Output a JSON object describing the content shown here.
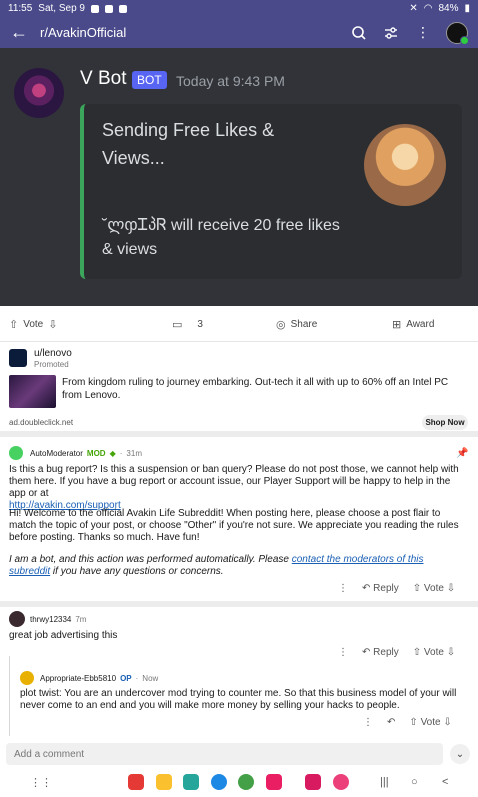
{
  "status_bar": {
    "time": "11:55",
    "date": "Sat, Sep 9",
    "battery": "84%"
  },
  "header": {
    "title": "r/AvakinOfficial"
  },
  "discord": {
    "bot_name": "V Bot",
    "bot_badge": "BOT",
    "timestamp": "Today at 9:43 PM",
    "embed_title": "Sending Free Likes & Views...",
    "embed_description": "˘ლჶᏆპᏒ will receive 20 free likes & views"
  },
  "post_actions": {
    "vote_label": "Vote",
    "comments_count": "3",
    "share_label": "Share",
    "award_label": "Award"
  },
  "promoted": {
    "user": "u/lenovo",
    "tag": "Promoted",
    "text": "From kingdom ruling to journey embarking. Out-tech it all with up to 60% off an Intel PC from Lenovo.",
    "domain": "ad.doubleclick.net",
    "cta": "Shop Now"
  },
  "comments": [
    {
      "author": "AutoModerator",
      "flair": "MOD",
      "age": "31m",
      "para1": "Is this a bug report? Is this a suspension or ban query? Please do not post those, we cannot help with them here. If you have a bug report or account issue, our Player Support will be happy to help in the app or at",
      "link1": "http://avakin.com/support",
      "para2": "Hi! Welcome to the official Avakin Life Subreddit! When posting here, please choose a post flair to match the topic of your post, or choose \"Other\" if you're not sure. We appreciate you reading the rules before posting. Thanks so much. Have fun!",
      "para3_a": "I am a bot, and this action was performed automatically. Please",
      "para3_link": "contact the moderators of this subreddit",
      "para3_b": "if you have any questions or concerns.",
      "reply_label": "Reply",
      "vote_label": "Vote"
    },
    {
      "author": "thrwy12334",
      "age": "7m",
      "text": "great job advertising this",
      "reply_label": "Reply",
      "vote_label": "Vote"
    },
    {
      "author": "Appropriate-Ebb5810",
      "flair": "OP",
      "age": "Now",
      "text": "plot twist: You are an undercover mod trying to counter me. So that this business model of your will never come to an end and you will make more money by selling your hacks to people.",
      "vote_label": "Vote"
    }
  ],
  "comment_bar": {
    "placeholder": "Add a comment"
  }
}
